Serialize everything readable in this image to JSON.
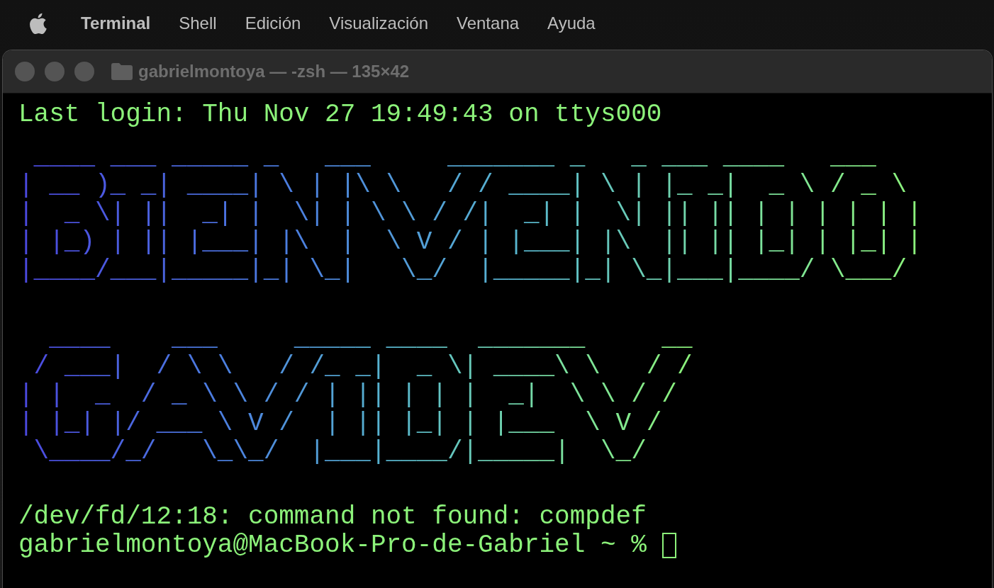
{
  "menu_bar": {
    "items": [
      {
        "label": "Terminal",
        "kind": "app"
      },
      {
        "label": "Shell",
        "kind": "menu"
      },
      {
        "label": "Edición",
        "kind": "menu"
      },
      {
        "label": "Visualización",
        "kind": "menu"
      },
      {
        "label": "Ventana",
        "kind": "menu"
      },
      {
        "label": "Ayuda",
        "kind": "menu"
      }
    ]
  },
  "window": {
    "title": "gabrielmontoya — -zsh — 135×42"
  },
  "terminal": {
    "lines": [
      {
        "kind": "text",
        "text": "Last login: Thu Nov 27 19:49:43 on ttys000"
      },
      {
        "kind": "ascii_art",
        "text": " ____ ___ _____ _   ___     _______ _   _ ___ ____   ___  \n| __ )_ _| ____| \\ | |\\ \\   / / ____| \\ | |_ _|  _ \\ / _ \\ \n|  _ \\| ||  _| |  \\| | \\ \\ / /|  _| |  \\| || || | | | | | |\n| |_) | || |___| |\\  |  \\ V / | |___| |\\  || || |_| | |_| |\n|____/___|_____|_| \\_|   \\_/  |_____|_| \\_|___|____/ \\___/ "
      },
      {
        "kind": "ascii_art",
        "text": "  ____    ___     _____ ____  _______     __\n / ___|  / \\ \\   / /_ _|  _ \\| ____\\ \\   / /\n| |  _  / _ \\ \\ / / | || | | |  _|  \\ \\ / / \n| |_| |/ ___ \\ V /  | || |_| | |___  \\ V /  \n \\____/_/   \\_\\_/  |___|____/|_____|  \\_/   "
      },
      {
        "kind": "text",
        "text": "/dev/fd/12:18: command not found: compdef"
      },
      {
        "kind": "prompt",
        "text": "gabrielmontoya@MacBook-Pro-de-Gabriel ~ %"
      }
    ]
  }
}
